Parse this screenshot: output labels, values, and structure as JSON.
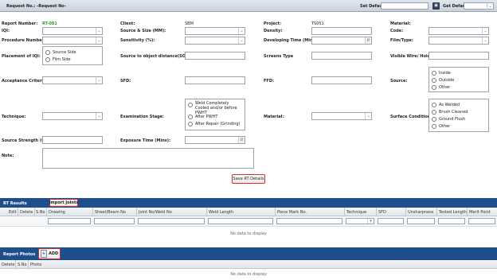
{
  "topbar": {
    "request_label": "Request No.: -Request No-",
    "set_default": "Set Default",
    "get_default": "Get Default"
  },
  "form": {
    "report_number_label": "Report Number:",
    "report_number_value": "RT-001",
    "iqi_label": "IQI:",
    "procedure_number_label": "Procedure Number:",
    "placement_iqi_label": "Placement of IQI:",
    "placement_options": [
      "Source Side",
      "Film Side"
    ],
    "acceptance_criteria_label": "Acceptance Criteria:",
    "technique_label": "Technique:",
    "source_strength_label": "Source Strength (Ci):",
    "note_label": "Note:",
    "client_label": "Client:",
    "client_value": "SBM",
    "source_size_label": "Source & Size (MM):",
    "sensitivity_label": "Sensitivity (%):",
    "source_object_distance_label": "Source to object distance(SOD):",
    "sfd_label": "SFD:",
    "examination_stage_label": "Examination Stage:",
    "examination_options": [
      "Weld Completely Cooled and/or before PWHT",
      "After PWHT",
      "After Repair (Grinding)"
    ],
    "exposure_time_label": "Exposure Time (Mins):",
    "project_label": "Project:",
    "project_value": "TS051",
    "density_label": "Density:",
    "developing_time_label": "Developing Time (Mins):",
    "screens_type_label": "Screens Type",
    "ffd_label": "FFD:",
    "material_mid_label": "Material:",
    "material_label": "Material:",
    "code_label": "Code:",
    "film_type_label": "Film/Type:",
    "visible_wire_label": "Visible Wire/ Hole",
    "source_label": "Source:",
    "source_options": [
      "Inside",
      "Outside",
      "Other"
    ],
    "surface_condition_label": "Surface Condition:",
    "surface_options": [
      "As Welded",
      "Brush Cleaned",
      "Ground Flush",
      "Other"
    ],
    "save_button": "Save RT Details"
  },
  "rt_results": {
    "title": "RT Results",
    "import_button": "Import Joints",
    "columns": [
      "Edit",
      "Delete",
      "S.No",
      "Drawing",
      "Sheet/Beam No",
      "Joint No/Weld No",
      "Weld Length",
      "Piece Mark No.",
      "Technique",
      "SFD",
      "Unsharpness",
      "Tested Length",
      "Merit Point"
    ],
    "no_data": "No data to display"
  },
  "report_photos": {
    "title": "Report Photos",
    "add_button": "ADD",
    "columns": [
      "Delete",
      "S.No",
      "Photo"
    ],
    "no_data": "No data to display"
  },
  "colors": {
    "header_bar": "#1f4e8c",
    "report_number": "#2a9d2a",
    "highlight_border": "#d92c2c"
  }
}
